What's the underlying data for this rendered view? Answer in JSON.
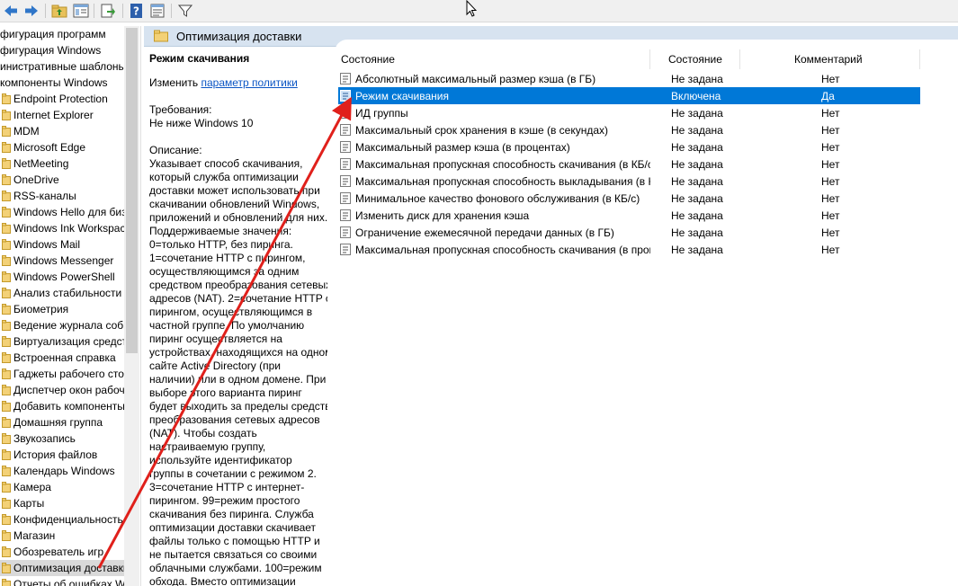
{
  "toolbar": {
    "icons": [
      "back-icon",
      "forward-icon",
      "up-folder-icon",
      "show-hide-tree-icon",
      "export-list-icon",
      "help-icon",
      "properties-icon",
      "filter-icon"
    ]
  },
  "tree": {
    "items": [
      {
        "label": "фигурация программ",
        "folder": false
      },
      {
        "label": "фигурация Windows",
        "folder": false
      },
      {
        "label": "инистративные шаблоны",
        "folder": false
      },
      {
        "label": "компоненты Windows",
        "folder": false
      },
      {
        "label": "Endpoint Protection",
        "folder": true
      },
      {
        "label": "Internet Explorer",
        "folder": true
      },
      {
        "label": "MDM",
        "folder": true
      },
      {
        "label": "Microsoft Edge",
        "folder": true
      },
      {
        "label": "NetMeeting",
        "folder": true
      },
      {
        "label": "OneDrive",
        "folder": true
      },
      {
        "label": "RSS-каналы",
        "folder": true
      },
      {
        "label": "Windows Hello для биз",
        "folder": true
      },
      {
        "label": "Windows Ink Workspac",
        "folder": true
      },
      {
        "label": "Windows Mail",
        "folder": true
      },
      {
        "label": "Windows Messenger",
        "folder": true
      },
      {
        "label": "Windows PowerShell",
        "folder": true
      },
      {
        "label": "Анализ стабильности",
        "folder": true
      },
      {
        "label": "Биометрия",
        "folder": true
      },
      {
        "label": "Ведение журнала собы",
        "folder": true
      },
      {
        "label": "Виртуализация средст",
        "folder": true
      },
      {
        "label": "Встроенная справка",
        "folder": true
      },
      {
        "label": "Гаджеты рабочего сто",
        "folder": true
      },
      {
        "label": "Диспетчер окон рабоч",
        "folder": true
      },
      {
        "label": "Добавить компоненты",
        "folder": true
      },
      {
        "label": "Домашняя группа",
        "folder": true
      },
      {
        "label": "Звукозапись",
        "folder": true
      },
      {
        "label": "История файлов",
        "folder": true
      },
      {
        "label": "Календарь Windows",
        "folder": true
      },
      {
        "label": "Камера",
        "folder": true
      },
      {
        "label": "Карты",
        "folder": true
      },
      {
        "label": "Конфиденциальность",
        "folder": true
      },
      {
        "label": "Магазин",
        "folder": true
      },
      {
        "label": "Обозреватель игр",
        "folder": true
      },
      {
        "label": "Оптимизация доставки",
        "folder": true,
        "selected": true
      },
      {
        "label": "Отчеты об ошибках W",
        "folder": true
      }
    ]
  },
  "panel": {
    "title": "Оптимизация доставки"
  },
  "description": {
    "heading": "Режим скачивания",
    "edit_prefix": "Изменить ",
    "edit_link": "параметр политики",
    "requirements_label": "Требования:",
    "requirements_value": "Не ниже Windows 10",
    "description_label": "Описание:",
    "lines": [
      "Указывает способ скачивания,",
      "который служба оптимизации",
      "доставки может использовать при",
      "скачивании обновлений Windows,",
      "приложений и обновлений для них.",
      "Поддерживаемые значения:",
      "0=только HTTP, без пиринга.",
      "1=сочетание HTTP с пирингом,",
      "осуществляющимся за одним",
      "средством преобразования сетевых",
      "адресов (NAT). 2=сочетание HTTP с",
      "пирингом, осуществляющимся в",
      "частной группе. По умолчанию",
      "пиринг осуществляется на",
      "устройствах, находящихся на одном",
      "сайте Active Directory (при",
      "наличии) или в одном домене. При",
      "выборе этого варианта пиринг",
      "будет выходить за пределы средств",
      "преобразования сетевых адресов",
      "(NAT). Чтобы создать",
      "настраиваемую группу,",
      "используйте идентификатор",
      "группы в сочетании с режимом 2.",
      "3=сочетание HTTP с интернет-",
      "пирингом. 99=режим простого",
      "скачивания без пиринга. Служба",
      "оптимизации доставки скачивает",
      "файлы только с помощью HTTP и",
      "не пытается связаться со своими",
      "облачными службами. 100=режим",
      "обхода. Вместо оптимизации"
    ]
  },
  "list": {
    "columns": {
      "name": "Состояние",
      "state": "Состояние",
      "comment": "Комментарий"
    },
    "rows": [
      {
        "name": "Абсолютный максимальный размер кэша (в ГБ)",
        "state": "Не задана",
        "comment": "Нет"
      },
      {
        "name": "Режим скачивания",
        "state": "Включена",
        "comment": "Да",
        "selected": true
      },
      {
        "name": "ИД группы",
        "state": "Не задана",
        "comment": "Нет"
      },
      {
        "name": "Максимальный срок хранения в кэше (в секундах)",
        "state": "Не задана",
        "comment": "Нет"
      },
      {
        "name": "Максимальный размер кэша (в процентах)",
        "state": "Не задана",
        "comment": "Нет"
      },
      {
        "name": "Максимальная пропускная способность скачивания (в КБ/с)",
        "state": "Не задана",
        "comment": "Нет"
      },
      {
        "name": "Максимальная пропускная способность выкладывания (в КБ/с)",
        "state": "Не задана",
        "comment": "Нет"
      },
      {
        "name": "Минимальное качество фонового обслуживания (в КБ/с)",
        "state": "Не задана",
        "comment": "Нет"
      },
      {
        "name": "Изменить диск для хранения кэша",
        "state": "Не задана",
        "comment": "Нет"
      },
      {
        "name": "Ограничение ежемесячной передачи данных (в ГБ)",
        "state": "Не задана",
        "comment": "Нет"
      },
      {
        "name": "Максимальная пропускная способность скачивания (в процентах)",
        "state": "Не задана",
        "comment": "Нет"
      }
    ]
  },
  "colors": {
    "selection": "#0078d7",
    "annotation_arrow": "#e0201b",
    "header_band": "#d7e3f0"
  }
}
